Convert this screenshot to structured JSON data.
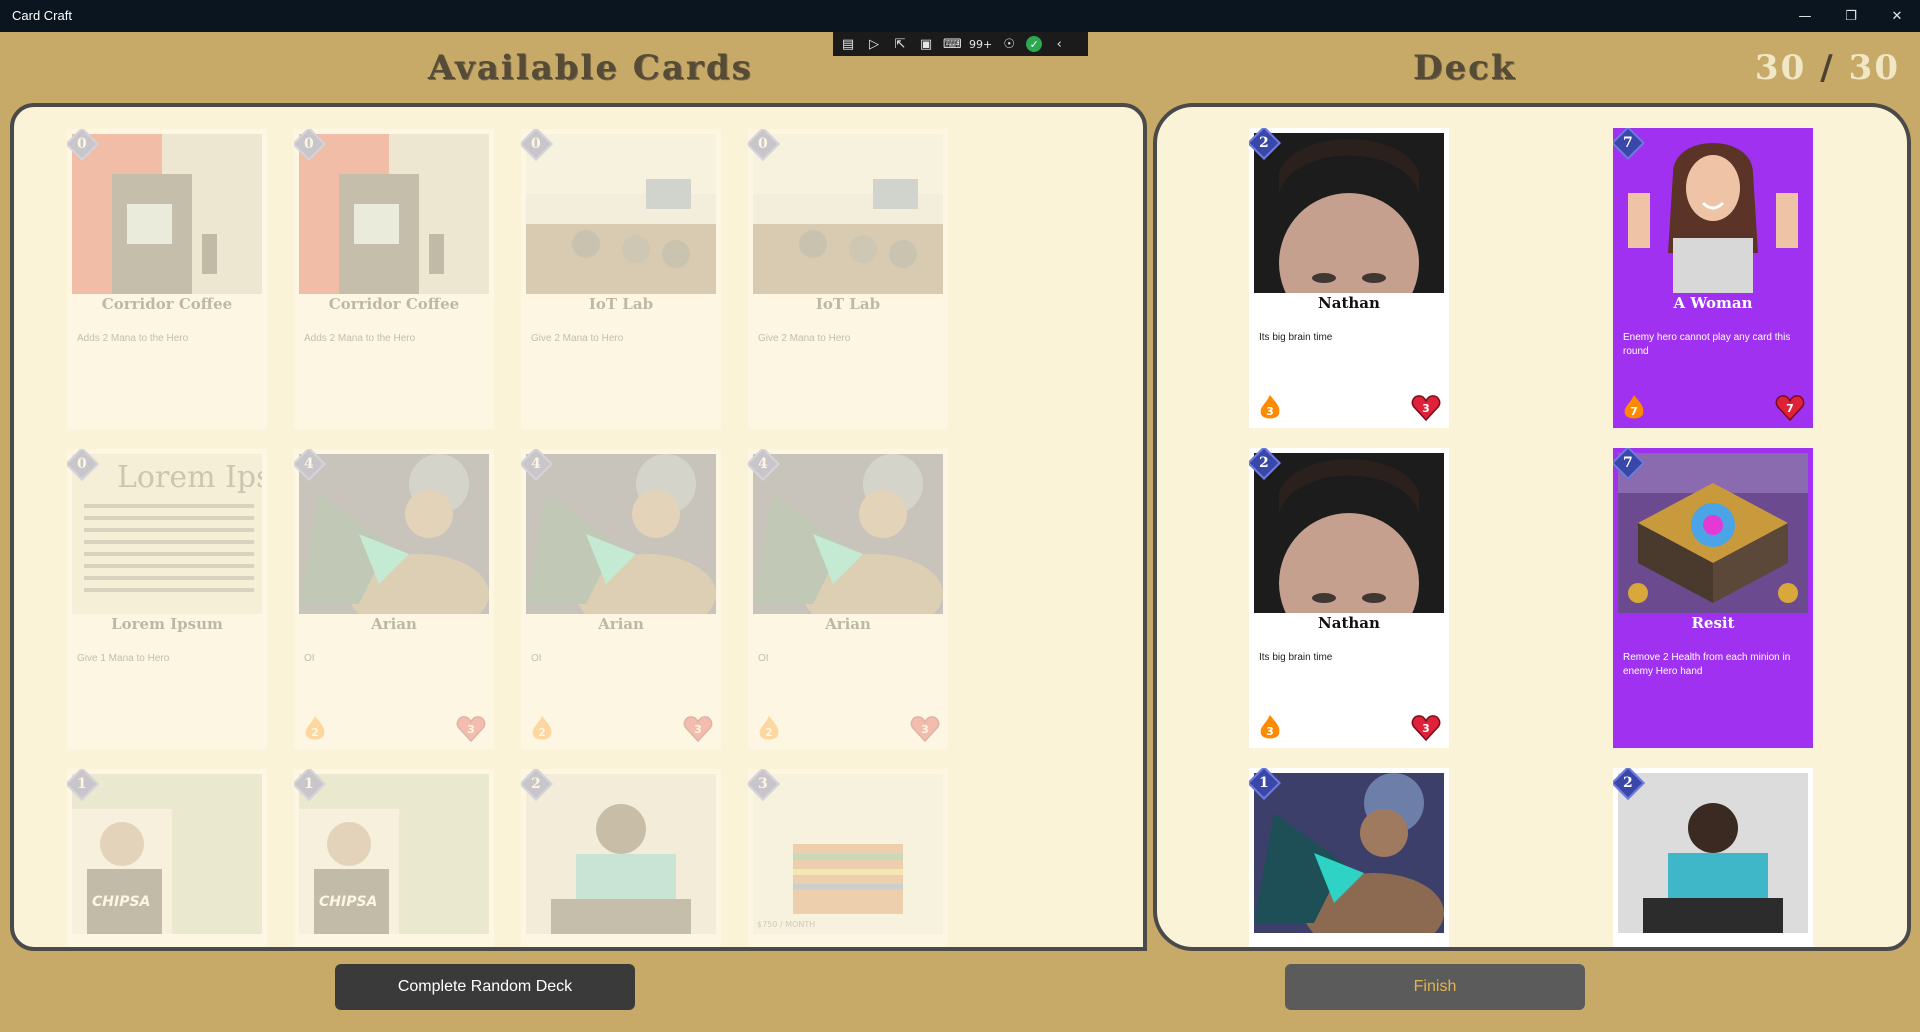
{
  "window": {
    "title": "Card Craft"
  },
  "game_bar": {
    "notification_count": "99+"
  },
  "headings": {
    "available": "Available Cards",
    "deck": "Deck"
  },
  "deck_count": {
    "current": "30",
    "separator": "/",
    "max": "30"
  },
  "available_cards": [
    {
      "name": "Corridor Coffee",
      "mana": "0",
      "desc": "Adds 2 Mana to the Hero",
      "art": "coffee-machine"
    },
    {
      "name": "Corridor Coffee",
      "mana": "0",
      "desc": "Adds 2 Mana to the Hero",
      "art": "coffee-machine"
    },
    {
      "name": "IoT Lab",
      "mana": "0",
      "desc": "Give 2 Mana to Hero",
      "art": "classroom"
    },
    {
      "name": "IoT Lab",
      "mana": "0",
      "desc": "Give 2 Mana to Hero",
      "art": "classroom"
    },
    {
      "name": "Lorem Ipsum",
      "mana": "0",
      "desc": "Give 1 Mana to Hero",
      "art": "lorem-text",
      "art_text": "Lorem Ips"
    },
    {
      "name": "Arian",
      "mana": "4",
      "desc": "OI",
      "art": "warrior",
      "attack": "2",
      "health": "3"
    },
    {
      "name": "Arian",
      "mana": "4",
      "desc": "OI",
      "art": "warrior",
      "attack": "2",
      "health": "3"
    },
    {
      "name": "Arian",
      "mana": "4",
      "desc": "OI",
      "art": "warrior",
      "attack": "2",
      "health": "3"
    },
    {
      "name": "",
      "mana": "1",
      "desc": "",
      "art": "person-chipsa",
      "art_text": "CHIPSA"
    },
    {
      "name": "",
      "mana": "1",
      "desc": "",
      "art": "person-chipsa",
      "art_text": "CHIPSA"
    },
    {
      "name": "",
      "mana": "2",
      "desc": "",
      "art": "praying-person"
    },
    {
      "name": "",
      "mana": "3",
      "desc": "",
      "art": "room-listing",
      "art_text": "$750 / MONTH"
    }
  ],
  "deck_cards": [
    {
      "name": "Nathan",
      "mana": "2",
      "desc": "Its big brain time",
      "art": "forehead",
      "attack": "3",
      "health": "3",
      "style": "white"
    },
    {
      "name": "A Woman",
      "mana": "7",
      "desc": "Enemy hero cannot play any card this round",
      "art": "woman-thumbs-up",
      "attack": "7",
      "health": "7",
      "style": "purple"
    },
    {
      "name": "Nathan",
      "mana": "2",
      "desc": "Its big brain time",
      "art": "forehead",
      "attack": "3",
      "health": "3",
      "style": "white"
    },
    {
      "name": "Resit",
      "mana": "7",
      "desc": "Remove 2 Health from each minion in enemy Hero hand",
      "art": "treasure-chest",
      "style": "purple"
    },
    {
      "name": "",
      "mana": "1",
      "desc": "",
      "art": "warrior",
      "style": "white"
    },
    {
      "name": "",
      "mana": "2",
      "desc": "",
      "art": "praying-person",
      "style": "white"
    }
  ],
  "buttons": {
    "random": "Complete Random Deck",
    "finish": "Finish"
  },
  "colors": {
    "background": "#c8aa68",
    "panel": "#fbf3d8",
    "purple_card": "#a131f0",
    "mana_badge": "#3947a8"
  }
}
